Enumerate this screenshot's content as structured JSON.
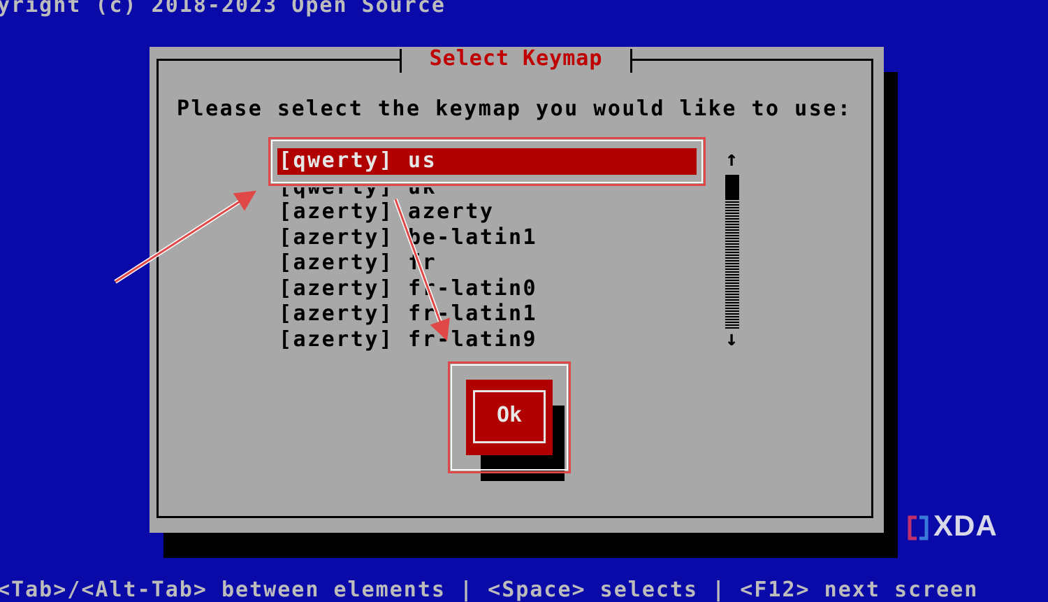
{
  "background": {
    "top_text": "yright (c) 2018-2023 Open Source",
    "bottom_text": "<Tab>/<Alt-Tab> between elements   |   <Space> selects   |   <F12> next screen"
  },
  "dialog": {
    "title": "Select Keymap",
    "prompt": "Please select the keymap you would like to use:",
    "items": [
      "[qwerty] us",
      "[qwerty] uk",
      "[azerty] azerty",
      "[azerty] be-latin1",
      "[azerty] fr",
      "[azerty] fr-latin0",
      "[azerty] fr-latin1",
      "[azerty] fr-latin9"
    ],
    "selected_index": 0,
    "scroll_up": "↑",
    "scroll_down": "↓",
    "ok_label": "Ok"
  },
  "watermark": {
    "text": "XDA"
  },
  "colors": {
    "screen_bg": "#0a0aa8",
    "dialog_bg": "#a8a8a8",
    "accent_red": "#b00000",
    "highlight": "#e04848"
  }
}
